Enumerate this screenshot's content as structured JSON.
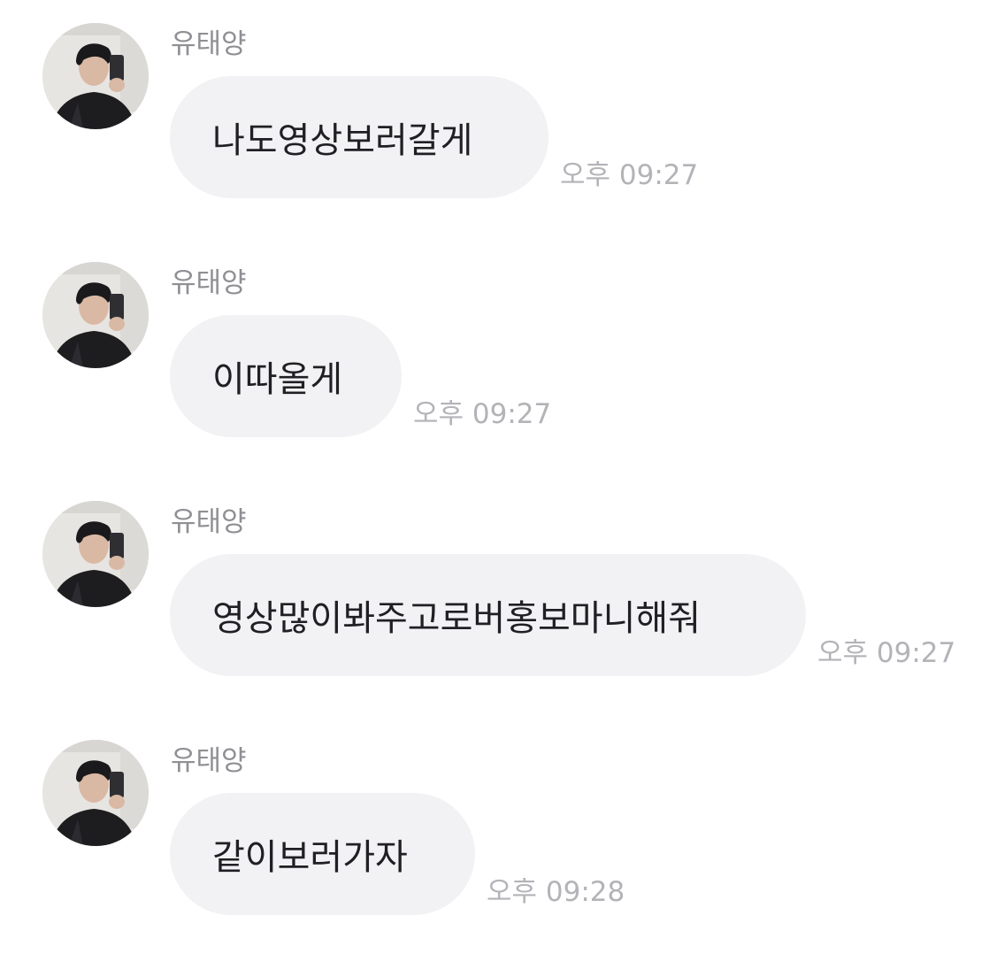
{
  "messages": [
    {
      "sender": "유태양",
      "text": "나도영상보러갈게",
      "time": "오후 09:27",
      "avatar": "profile-photo"
    },
    {
      "sender": "유태양",
      "text": "이따올게",
      "time": "오후 09:27",
      "avatar": "profile-photo"
    },
    {
      "sender": "유태양",
      "text": "영상많이봐주고로버홍보마니해줘",
      "time": "오후 09:27",
      "avatar": "profile-photo"
    },
    {
      "sender": "유태양",
      "text": "같이보러가자",
      "time": "오후 09:28",
      "avatar": "profile-photo"
    }
  ],
  "colors": {
    "bubble": "#f2f2f4",
    "sender": "#8f8f94",
    "time": "#b3b3b8",
    "text": "#202024"
  }
}
